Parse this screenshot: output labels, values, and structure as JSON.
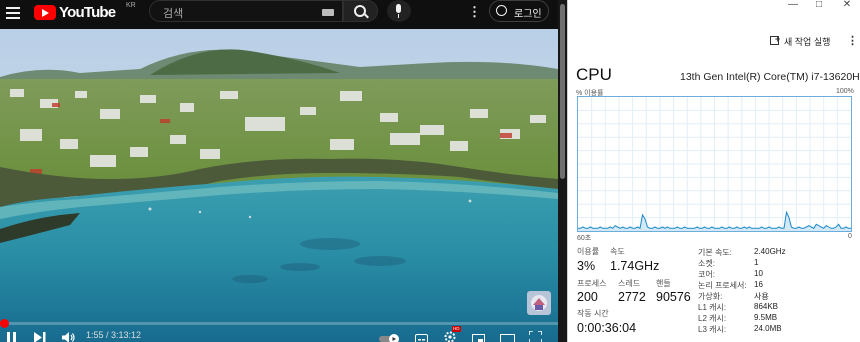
{
  "youtube": {
    "logo_text": "YouTube",
    "region": "KR",
    "search_placeholder": "검색",
    "login_label": "로그인",
    "more_icon": "⋮",
    "progress_fraction": 0.005,
    "time_display": "1:55 / 3:13:12",
    "icons": [
      "menu-icon",
      "search-icon",
      "keyboard-icon",
      "mic-icon",
      "more-icon",
      "account-icon",
      "pause-icon",
      "next-icon",
      "volume-icon",
      "autoplay-toggle-icon",
      "subtitles-icon",
      "settings-icon",
      "miniplayer-icon",
      "theater-icon",
      "fullscreen-icon"
    ],
    "settings_badge": "HD"
  },
  "task_manager": {
    "new_task_label": "새 작업 실행",
    "more_icon": "⋮",
    "title": "CPU",
    "cpu_model": "13th Gen Intel(R) Core(TM) i7-13620H",
    "usage_label": "% 이용률",
    "max_label": "100%",
    "time_span": "60초",
    "min_label": "0",
    "graph_color": "#1a88c9",
    "graph_fill": "#d4e9f7",
    "stats": {
      "utilization_label": "이용률",
      "utilization_value": "3%",
      "speed_label": "속도",
      "speed_value": "1.74GHz",
      "processes_label": "프로세스",
      "processes_value": "200",
      "threads_label": "스레드",
      "threads_value": "2772",
      "handles_label": "핸들",
      "handles_value": "90576",
      "uptime_label": "작동 시간",
      "uptime_value": "0:00:36:04"
    },
    "specs": [
      {
        "key": "기본 속도:",
        "value": "2.40GHz"
      },
      {
        "key": "소켓:",
        "value": "1"
      },
      {
        "key": "코어:",
        "value": "10"
      },
      {
        "key": "논리 프로세서:",
        "value": "16"
      },
      {
        "key": "가상화:",
        "value": "사용"
      },
      {
        "key": "L1 캐시:",
        "value": "864KB"
      },
      {
        "key": "L2 캐시:",
        "value": "9.5MB"
      },
      {
        "key": "L3 캐시:",
        "value": "24.0MB"
      }
    ],
    "usage_history": [
      2,
      2,
      3,
      2,
      2,
      3,
      2,
      2,
      2,
      3,
      2,
      2,
      2,
      3,
      2,
      4,
      3,
      2,
      3,
      2,
      2,
      3,
      2,
      2,
      3,
      2,
      12,
      9,
      3,
      2,
      2,
      3,
      2,
      2,
      3,
      2,
      3,
      2,
      2,
      2,
      3,
      2,
      2,
      3,
      2,
      2,
      2,
      2,
      3,
      2,
      2,
      3,
      2,
      2,
      3,
      2,
      2,
      2,
      3,
      2,
      2,
      3,
      2,
      2,
      3,
      2,
      2,
      3,
      2,
      3,
      2,
      2,
      2,
      2,
      3,
      2,
      2,
      3,
      2,
      2,
      2,
      3,
      2,
      2,
      14,
      10,
      3,
      2,
      2,
      3,
      2,
      2,
      3,
      4,
      3,
      2,
      5,
      4,
      3,
      2,
      4,
      3,
      2,
      2,
      3,
      5,
      2,
      2,
      3,
      2,
      2
    ]
  }
}
